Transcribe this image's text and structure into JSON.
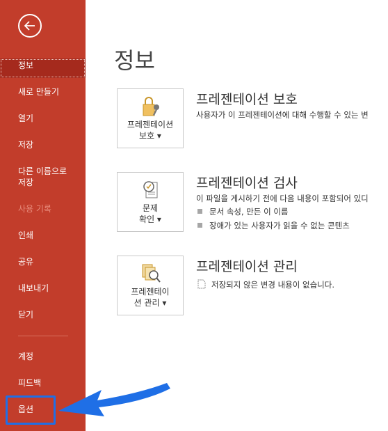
{
  "sidebar": {
    "back_icon": "back-arrow-icon",
    "items": [
      {
        "label": "정보",
        "state": "active"
      },
      {
        "label": "새로 만들기",
        "state": "normal"
      },
      {
        "label": "열기",
        "state": "normal"
      },
      {
        "label": "저장",
        "state": "normal"
      },
      {
        "label": "다른 이름으로\n저장",
        "state": "normal"
      },
      {
        "label": "사용 기록",
        "state": "disabled"
      },
      {
        "label": "인쇄",
        "state": "normal"
      },
      {
        "label": "공유",
        "state": "normal"
      },
      {
        "label": "내보내기",
        "state": "normal"
      },
      {
        "label": "닫기",
        "state": "normal"
      },
      {
        "label": "계정",
        "state": "normal"
      },
      {
        "label": "피드백",
        "state": "normal"
      },
      {
        "label": "옵션",
        "state": "highlighted"
      }
    ]
  },
  "main": {
    "title": "정보",
    "sections": [
      {
        "button_label_1": "프레젠테이션",
        "button_label_2": "보호 ▾",
        "heading": "프레젠테이션 보호",
        "description": "사용자가 이 프레젠테이션에 대해 수행할 수 있는 변"
      },
      {
        "button_label_1": "문제",
        "button_label_2": "확인 ▾",
        "heading": "프레젠테이션 검사",
        "description": "이 파일을 게시하기 전에 다음 내용이 포함되어 있디",
        "bullets": [
          "문서 속성, 만든 이 이름",
          "장애가 있는 사용자가 읽을 수 없는 콘텐츠"
        ]
      },
      {
        "button_label_1": "프레젠테이",
        "button_label_2": "션 관리 ▾",
        "heading": "프레젠테이션 관리",
        "description": "저장되지 않은 변경 내용이 없습니다."
      }
    ]
  },
  "colors": {
    "sidebar_bg": "#c23d2b",
    "sidebar_active": "#a52a1d",
    "annotation_blue": "#1f6fe6"
  }
}
